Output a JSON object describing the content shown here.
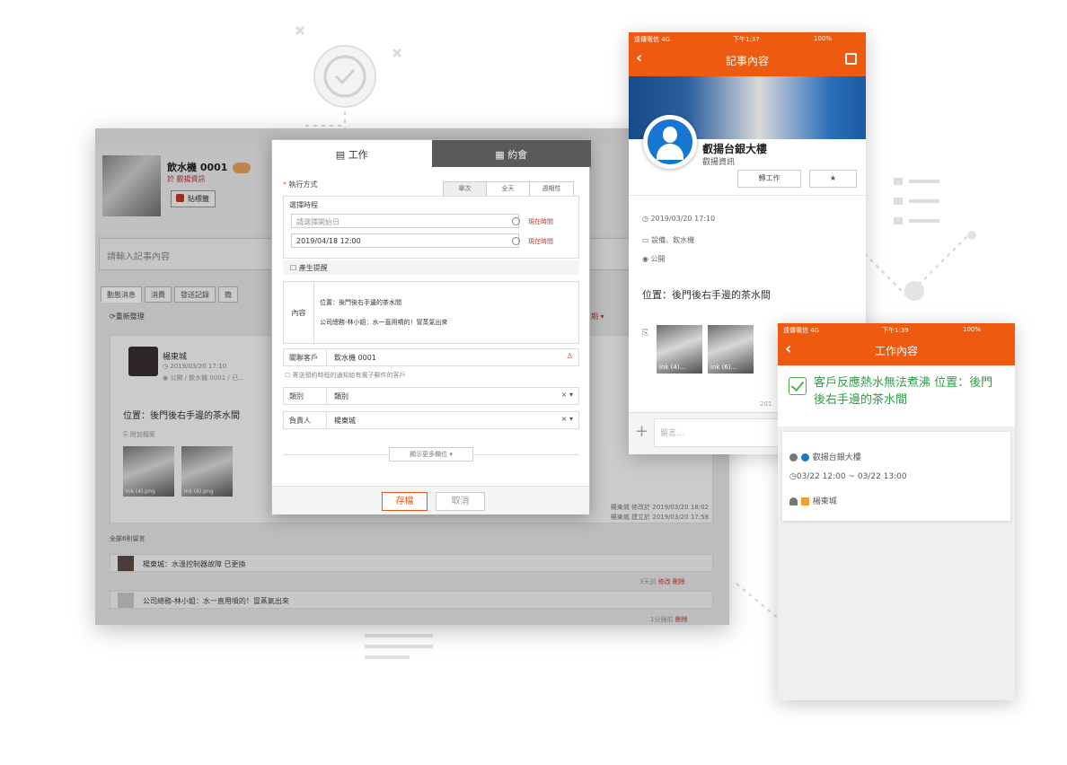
{
  "desktop": {
    "record_name": "飲水機 0001",
    "record_sub": "於 叡揚資訊",
    "tag_button": "貼標籤",
    "note_placeholder": "請輸入記事內容",
    "tabs": [
      "動態消息",
      "消費",
      "發送記錄",
      "簡"
    ],
    "refresh": "重新整理",
    "filter_label": "日期 ▾",
    "feed": {
      "user": "楊東城",
      "time": "2019/03/20 17:10",
      "meta": "公開 / 飲水機 0001 / 已...",
      "location": "位置：後門後右手邊的茶水間",
      "attachments_label": "附加檔案",
      "images": [
        "ink (4).png",
        "ink (6).png"
      ],
      "edit_line1": "楊東城 修改於 2019/03/20 18:02",
      "edit_line2": "楊東城 建立於 2019/03/20 17:58"
    },
    "comments_title": "全部6則留言",
    "comments": [
      {
        "text": "楊東城：水溫控制器故障 已更換",
        "meta": "3天前",
        "actions": "修改 刪除"
      },
      {
        "text": "公司總務-林小姐：水一直用噴的！冒蒸氣出來",
        "meta": "1分鐘前",
        "actions": "刪除"
      }
    ]
  },
  "dialog": {
    "tab_work": "工作",
    "tab_meeting": "約會",
    "exec_label": "執行方式",
    "exec_required": "*",
    "modes": [
      "單次",
      "全天",
      "週期性"
    ],
    "schedule_label": "選擇時程",
    "start_placeholder": "請選擇開始日",
    "end_value": "2019/04/18 12:00",
    "now_link": "現在時間",
    "reminder_label": "產生提醒",
    "content_label": "內容",
    "content_lines": [
      "位置：後門後右手邊的茶水間",
      "公司總務-林小姐：水一直用噴的！冒蒸氣出來"
    ],
    "customer_label": "關聯客戶",
    "customer_value": "飲水機 0001",
    "email_option": "寄送預約時程的通知給有電子郵件的客戶",
    "category_label": "類別",
    "category_value": "類別",
    "owner_label": "負責人",
    "owner_value": "楊東城",
    "more_fields": "顯示更多欄位 ▾",
    "save": "存檔",
    "cancel": "取消"
  },
  "phone1": {
    "status_left": "遠傳電信 4G",
    "status_time": "下午1:37",
    "status_right": "100%",
    "title": "記事內容",
    "name": "叡揚台銀大樓",
    "company": "叡揚資訊",
    "to_work": "轉工作",
    "star": "★",
    "time": "2019/03/20 17:10",
    "category": "設備、飲水機",
    "visibility": "公開",
    "location": "位置：後門後右手邊的茶水間",
    "images": [
      "ink (4)...",
      "ink (6)..."
    ],
    "date_fragment": "201",
    "comment_placeholder": "留言..."
  },
  "phone2": {
    "status_left": "遠傳電信 4G",
    "status_time": "下午1:39",
    "status_right": "100%",
    "title": "工作內容",
    "task": "客戶反應熱水無法煮沸 位置：後門後右手邊的茶水間",
    "company": "叡揚台銀大樓",
    "time_range": "03/22 12:00 ~ 03/22 13:00",
    "owner": "楊東城"
  },
  "colors": {
    "accent": "#ee5a10",
    "success": "#2e9e4a",
    "link_red": "#c0392b"
  }
}
